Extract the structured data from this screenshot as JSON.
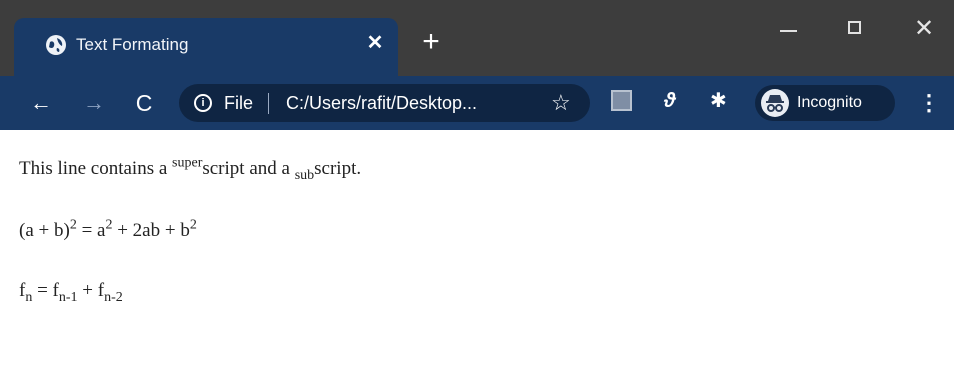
{
  "tab": {
    "title": "Text Formating",
    "close": "✕"
  },
  "new_tab": "+",
  "window": {
    "close": "✕"
  },
  "nav": {
    "back": "←",
    "forward": "→",
    "reload": "C"
  },
  "omnibox": {
    "file": "File",
    "url": "C:/Users/rafit/Desktop...",
    "star": "☆"
  },
  "extensions": {
    "ext2": "ϑ",
    "puzzle": "✱"
  },
  "profile": {
    "label": "Incognito"
  },
  "menu": "⋮",
  "page": {
    "line1": {
      "a": "This line contains a ",
      "sup": "super",
      "b": "script and a ",
      "sub": "sub",
      "c": "script."
    },
    "line2": {
      "a": "(a + b)",
      "sup1": "2",
      "b": " = a",
      "sup2": "2",
      "c": " + 2ab + b",
      "sup3": "2"
    },
    "line3": {
      "a": "f",
      "sub1": "n",
      "b": " = f",
      "sub2": "n-1",
      "c": " + f",
      "sub3": "n-2"
    }
  },
  "colors": {
    "titlebar": "#3d3d3d",
    "toolbar": "#193a67",
    "omnibox": "#0f2543"
  }
}
